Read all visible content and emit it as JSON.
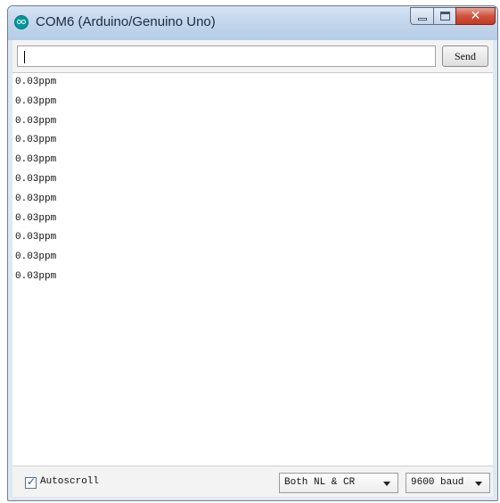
{
  "window": {
    "title": "COM6 (Arduino/Genuino Uno)"
  },
  "input": {
    "value": ""
  },
  "buttons": {
    "send": "Send"
  },
  "output": {
    "lines": [
      "0.03ppm",
      "0.03ppm",
      "0.03ppm",
      "0.03ppm",
      "0.03ppm",
      "0.03ppm",
      "0.03ppm",
      "0.03ppm",
      "0.03ppm",
      "0.03ppm",
      "0.03ppm"
    ]
  },
  "footer": {
    "autoscroll_label": "Autoscroll",
    "autoscroll_checked": true,
    "line_ending": "Both NL & CR",
    "baud_rate": "9600 baud"
  },
  "icons": {
    "app": "arduino-icon",
    "minimize": "minimize-icon",
    "maximize": "maximize-icon",
    "close": "close-icon",
    "dropdown": "chevron-down-icon"
  },
  "colors": {
    "arduino_teal": "#00979c",
    "close_red": "#c03a24"
  }
}
